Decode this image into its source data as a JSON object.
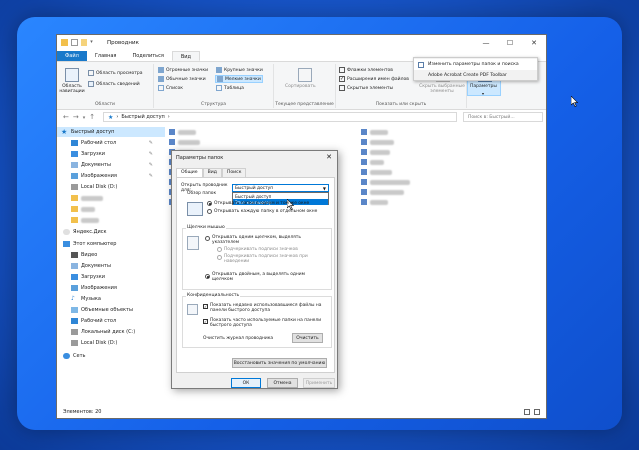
{
  "window": {
    "title": "Проводник",
    "controls": {
      "minimize": "—",
      "maximize": "☐",
      "close": "✕"
    }
  },
  "ribbon_tabs": [
    "Файл",
    "Главная",
    "Поделиться",
    "Вид"
  ],
  "ribbon": {
    "panels": {
      "label": "Области",
      "nav_pane_line1": "Область",
      "nav_pane_line2": "навигации",
      "preview_pane": "Область просмотра",
      "details_pane": "Область сведений"
    },
    "layout": {
      "label": "Структура",
      "items": [
        "Огромные значки",
        "Крупные значки",
        "Обычные значки",
        "Мелкие значки",
        "Список",
        "Таблица"
      ]
    },
    "current_view": {
      "label": "Текущее представление",
      "sort": "Сортировать"
    },
    "show_hide": {
      "label": "Показать или скрыть",
      "item_checkboxes": "Флажки элементов",
      "file_extensions": "Расширения имен файлов",
      "hidden_items": "Скрытые элементы",
      "hide_selected_line1": "Скрыть выбранные",
      "hide_selected_line2": "элементы"
    },
    "options": {
      "label": "Параметры"
    }
  },
  "options_menu": {
    "change_folder_options": "Изменить параметры папок и поиска",
    "adobe_toolbar": "Adobe Acrobat Create PDF Toolbar"
  },
  "address": {
    "path": "Быстрый доступ",
    "search_placeholder": "Поиск в: Быстрый..."
  },
  "nav_pane": {
    "quick_access": "Быстрый доступ",
    "desktop": "Рабочий стол",
    "downloads": "Загрузки",
    "documents": "Документы",
    "pictures": "Изображения",
    "local_disk_d": "Local Disk (D:)",
    "yandex_disk": "Яндекс.Диск",
    "this_pc": "Этот компьютер",
    "video": "Видео",
    "documents2": "Документы",
    "downloads2": "Загрузки",
    "pictures2": "Изображения",
    "music": "Музыка",
    "objects_3d": "Объемные объекты",
    "desktop2": "Рабочий стол",
    "local_disk_c": "Локальный диск (C:)",
    "local_disk_d2": "Local Disk (D:)",
    "network": "Сеть"
  },
  "status": {
    "items": "Элементов: 20"
  },
  "dialog": {
    "title": "Параметры папок",
    "close": "✕",
    "tabs": [
      "Общие",
      "Вид",
      "Поиск"
    ],
    "open_explorer_line1": "Открыть проводник",
    "open_explorer_line2": "для:",
    "open_explorer_value": "Быстрый доступ",
    "combo_options": [
      "Быстрый доступ",
      "Этот компьютер"
    ],
    "browse_folders": "Обзор папок",
    "open_same_window": "Открывать папки в одном и том же окне",
    "open_new_window": "Открывать каждую папку в отдельном окне",
    "clicks_legend": "Щелчки мышью",
    "single_click_line1": "Открывать одним щелчком, выделять",
    "single_click_line2": "указателем",
    "underline_always": "Подчеркивать подписи значков",
    "underline_hover_line1": "Подчеркивать подписи значков при",
    "underline_hover_line2": "наведении",
    "double_click_line1": "Открывать двойным, а выделять одним",
    "double_click_line2": "щелчком",
    "privacy_legend": "Конфиденциальность",
    "recent_files_line1": "Показать недавно использовавшиеся файлы на",
    "recent_files_line2": "панели быстрого доступа",
    "frequent_folders_line1": "Показать часто используемые папки на панели",
    "frequent_folders_line2": "быстрого доступа",
    "clear_history": "Очистить журнал проводника",
    "clear_button": "Очистить",
    "restore_defaults": "Восстановить значения по умолчанию",
    "ok": "ОК",
    "cancel": "Отмена",
    "apply": "Применить"
  },
  "colors": {
    "accent": "#0078d7",
    "file_tab": "#1979ca",
    "selection": "#cce8ff",
    "folder": "#f2c04c"
  }
}
